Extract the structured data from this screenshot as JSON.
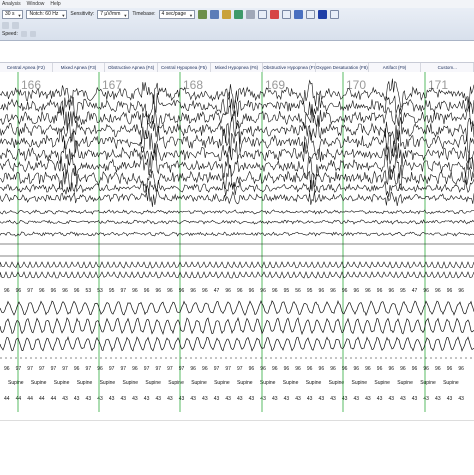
{
  "menu": [
    "Analysis",
    "Window",
    "Help"
  ],
  "toolbar": {
    "display_value": "30 s",
    "notch_label": "Notch: 60 Hz",
    "sensitivity_label": "Sensitivity:",
    "sensitivity_value": "7 µV/mm",
    "timebase_label": "Timebase:",
    "timebase_value": "4 sec/page",
    "speed_label": "Speed:"
  },
  "events": [
    "Central Apnea (F2)",
    "Mixed Apnea (F3)",
    "Obstructive Apnea (F4)",
    "Central Hypopnea (F5)",
    "Mixed Hypopnea (F6)",
    "Obstructive Hypopnea (F7)",
    "Oxygen Desaturation (F8)",
    "Artifact (F9)",
    "Custom..."
  ],
  "epochs": [
    "166",
    "167",
    "168",
    "169",
    "170",
    "171"
  ],
  "spo2_row": [
    "96",
    "96",
    "97",
    "96",
    "96",
    "96",
    "96",
    "53",
    "53",
    "95",
    "97",
    "96",
    "96",
    "96",
    "96",
    "96",
    "96",
    "96",
    "47",
    "96",
    "96",
    "96",
    "96",
    "96",
    "95",
    "56",
    "95",
    "96",
    "96",
    "96",
    "96",
    "96",
    "96",
    "96",
    "95",
    "47",
    "96",
    "96",
    "96",
    "96"
  ],
  "sao2_row": [
    "96",
    "97",
    "97",
    "97",
    "97",
    "97",
    "96",
    "97",
    "96",
    "97",
    "97",
    "96",
    "97",
    "97",
    "97",
    "97",
    "96",
    "96",
    "97",
    "97",
    "97",
    "96",
    "96",
    "96",
    "96",
    "96",
    "96",
    "96",
    "96",
    "96",
    "96",
    "96",
    "96",
    "96",
    "96",
    "96",
    "96",
    "96",
    "96",
    "96"
  ],
  "position_row": [
    "Supine",
    "Supine",
    "Supine",
    "Supine",
    "Supine",
    "Supine",
    "Supine",
    "Supine",
    "Supine",
    "Supine",
    "Supine",
    "Supine",
    "Supine",
    "Supine",
    "Supine",
    "Supine",
    "Supine",
    "Supine",
    "Supine",
    "Supine"
  ],
  "hr_row": [
    "44",
    "44",
    "44",
    "44",
    "44",
    "43",
    "43",
    "43",
    "43",
    "43",
    "43",
    "43",
    "43",
    "43",
    "43",
    "43",
    "43",
    "43",
    "43",
    "43",
    "43",
    "43",
    "43",
    "43",
    "43",
    "43",
    "43",
    "43",
    "43",
    "43",
    "43",
    "43",
    "43",
    "43",
    "43",
    "43",
    "43",
    "43",
    "43",
    "43"
  ],
  "colors": {
    "trace": "#111111",
    "epoch_line": "#2eaa3c",
    "event_text": "#1a2d5a",
    "epoch_number": "#9a9a9a"
  }
}
